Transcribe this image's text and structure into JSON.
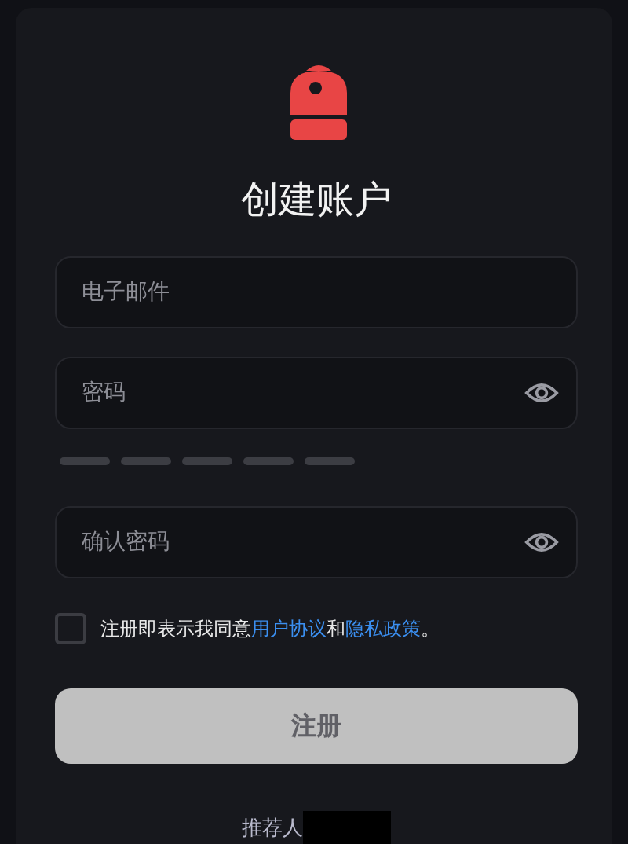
{
  "title": "创建账户",
  "fields": [
    {
      "kind": "email",
      "placeholder": "电子邮件"
    },
    {
      "kind": "password",
      "placeholder": "密码"
    },
    {
      "kind": "strength",
      "bars": [
        {
          "filled": false
        },
        {
          "filled": false
        },
        {
          "filled": false
        },
        {
          "filled": false
        },
        {
          "filled": false
        }
      ]
    },
    {
      "kind": "password",
      "placeholder": "确认密码"
    }
  ],
  "agreement": {
    "checked": false,
    "text": "注册即表示我同意",
    "link1": "用户协议",
    "conj": "和",
    "link2": "隐私政策",
    "end": "。"
  },
  "submit": {
    "label": "注册",
    "disabled": true
  },
  "referrer": {
    "label": "推荐人"
  }
}
